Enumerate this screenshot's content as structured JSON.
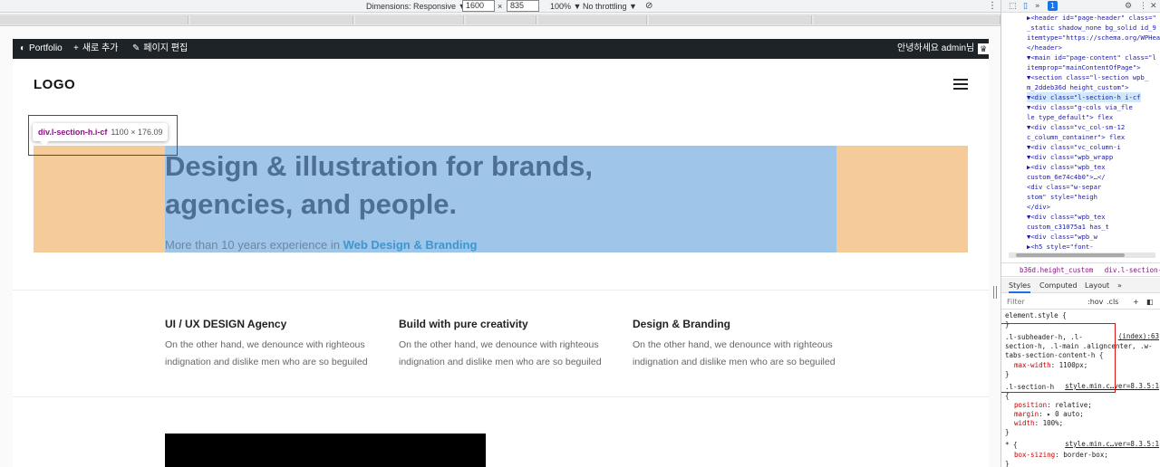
{
  "devtools_toolbar": {
    "dimensions_label": "Dimensions: Responsive ▼",
    "width_value": "1600",
    "times": "×",
    "height_value": "835",
    "zoom": "100% ▼",
    "throttle": "No throttling ▼"
  },
  "admin_bar": {
    "site": "Portfolio",
    "new": "새로 추가",
    "edit": "페이지 편집",
    "greeting": "안녕하세요 admin님"
  },
  "header": {
    "logo": "LOGO"
  },
  "inspect_tooltip": {
    "selector": "div.l-section-h.i-cf",
    "size": "1100 × 176.09"
  },
  "hero": {
    "title": "Design & illustration for brands, agencies, and people.",
    "subtitle_prefix": "More than 10 years experience in ",
    "subtitle_accent": "Web Design & Branding"
  },
  "features": [
    {
      "title": "UI / UX DESIGN Agency",
      "text": "On the other hand, we denounce with righteous indignation and dislike men who are so beguiled"
    },
    {
      "title": "Build with pure creativity",
      "text": "On the other hand, we denounce with righteous indignation and dislike men who are so beguiled"
    },
    {
      "title": "Design & Branding",
      "text": "On the other hand, we denounce with righteous indignation and dislike men who are so beguiled"
    }
  ],
  "devtools": {
    "badge": "1",
    "tree": [
      "▶<header id=\"page-header\" class=\"",
      "_static shadow_none bg_solid id_9",
      "itemtype=\"https://schema.org/WPHea",
      "</header>",
      "▼<main id=\"page-content\" class=\"l",
      "itemprop=\"mainContentOfPage\">",
      " ▼<section class=\"l-section wpb_",
      " m_2ddeb36d height_custom\">",
      "  ▼<div class=\"l-section-h i-cf",
      "   ▼<div class=\"g-cols via_fle",
      "   le type_default\"> flex",
      "    ▼<div class=\"vc_col-sm-12",
      "    c_column_container\"> flex",
      "     ▼<div class=\"vc_column-i",
      "      ▼<div class=\"wpb_wrapp",
      "       ▶<div class=\"wpb_tex",
      "       custom_6e74c4b0\">…</",
      "        <div class=\"w-separ",
      "        stom\" style=\"heigh",
      "        </div>",
      "       ▼<div class=\"wpb_tex",
      "       custom_c31075a1 has_t",
      "        ▼<div class=\"wpb_w",
      "         ▶<h5 style=\"font-"
    ],
    "crumb_1": "b36d.height_custom",
    "crumb_2": "div.l-section-h.i-cf",
    "tab_styles": "Styles",
    "tab_computed": "Computed",
    "tab_layout": "Layout",
    "tab_more": "»",
    "filter_placeholder": "Filter",
    "filter_hov": ":hov",
    "filter_cls": ".cls",
    "element_style": "element.style {",
    "close_brace": "}",
    "rule1_selector_a": ".l-subheader-h, .l-",
    "rule1_selector_b": "section-h, .l-main .aligncenter, .w-",
    "rule1_selector_c": "tabs-section-content-h {",
    "rule1_source": "(index):63",
    "rule1_prop": "max-width",
    "rule1_val": "1100px;",
    "rule2_selector": ".l-section-h",
    "rule2_source": "style.min.c…ver=8.3.5:1",
    "rule2_open": "{",
    "rule2_p1": "position",
    "rule2_v1": "relative;",
    "rule2_p2": "margin",
    "rule2_v2": "▸ 0 auto;",
    "rule2_p3": "width",
    "rule2_v3": "100%;",
    "rule3_selector": "* {",
    "rule3_source": "style.min.c…ver=8.3.5:1",
    "rule3_p1": "box-sizing",
    "rule3_v1": "border-box;"
  }
}
